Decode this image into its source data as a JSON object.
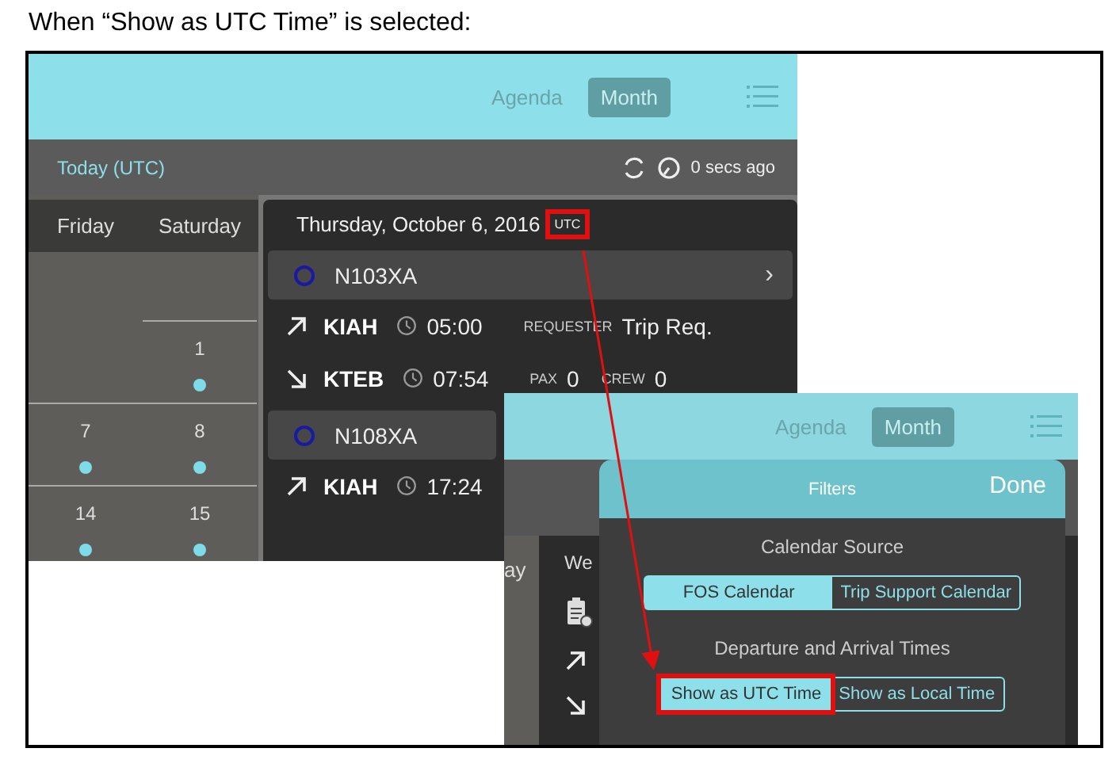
{
  "caption": "When “Show as UTC Time” is selected:",
  "screenshots": [
    {
      "tabs": [
        {
          "label": "Agenda",
          "selected": false
        },
        {
          "label": "Month",
          "selected": true
        }
      ],
      "toolbar": {
        "today": "Today (UTC)",
        "updated": "0 secs ago"
      },
      "calendar": {
        "weekdays": [
          "Friday",
          "Saturday"
        ],
        "weeks": [
          [
            {
              "kind": "blank"
            },
            {
              "kind": "day",
              "label": "1",
              "dot": true
            }
          ],
          [
            {
              "kind": "day",
              "label": "7",
              "dot": true
            },
            {
              "kind": "day",
              "label": "8",
              "dot": true
            }
          ],
          [
            {
              "kind": "day",
              "label": "14",
              "dot": true
            },
            {
              "kind": "day",
              "label": "15",
              "dot": true
            }
          ]
        ]
      },
      "day": {
        "date": "Thursday, October 6, 2016",
        "zone": "UTC",
        "zone_highlight": true,
        "aircraft": [
          {
            "tail": "N103XA",
            "chevron": "›",
            "legs": [
              {
                "kind": "departure",
                "airport": "KIAH",
                "time": "05:00",
                "fields": [
                  {
                    "label": "REQUESTER",
                    "value": "Trip Req."
                  }
                ]
              },
              {
                "kind": "arrival",
                "airport": "KTEB",
                "time": "07:54",
                "fields": [
                  {
                    "label": "PAX",
                    "value": "0"
                  },
                  {
                    "label": "CREW",
                    "value": "0"
                  }
                ]
              }
            ]
          },
          {
            "tail": "N108XA",
            "legs": [
              {
                "kind": "departure",
                "airport": "KIAH",
                "time": "17:24"
              }
            ]
          }
        ]
      }
    },
    {
      "tabs": [
        {
          "label": "Agenda",
          "selected": false
        },
        {
          "label": "Month",
          "selected": true
        }
      ],
      "background": {
        "day_tab": "ay",
        "week_tab": "We"
      },
      "filters": {
        "title": "Filters",
        "done": "Done",
        "sections": [
          {
            "heading": "Calendar Source",
            "options": [
              {
                "label": "FOS Calendar",
                "selected": true,
                "highlight": false
              },
              {
                "label": "Trip Support Calendar",
                "selected": false,
                "highlight": false
              }
            ]
          },
          {
            "heading": "Departure and Arrival Times",
            "options": [
              {
                "label": "Show as UTC Time",
                "selected": true,
                "highlight": true
              },
              {
                "label": "Show as Local Time",
                "selected": false,
                "highlight": false
              }
            ]
          }
        ]
      }
    }
  ]
}
